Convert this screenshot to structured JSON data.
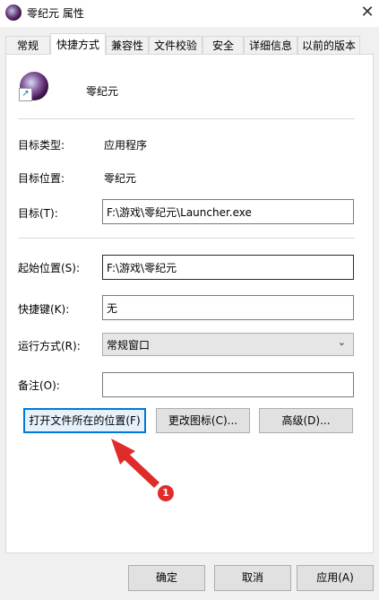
{
  "window": {
    "title": "零纪元 属性",
    "close_glyph": "✕"
  },
  "tabs": [
    {
      "label": "常规"
    },
    {
      "label": "快捷方式",
      "active": true
    },
    {
      "label": "兼容性"
    },
    {
      "label": "文件校验"
    },
    {
      "label": "安全"
    },
    {
      "label": "详细信息"
    },
    {
      "label": "以前的版本"
    }
  ],
  "shortcut": {
    "name": "零纪元",
    "target_type_label": "目标类型:",
    "target_type_value": "应用程序",
    "target_location_label": "目标位置:",
    "target_location_value": "零纪元",
    "target_label": "目标(T):",
    "target_value": "F:\\游戏\\零纪元\\Launcher.exe",
    "start_in_label": "起始位置(S):",
    "start_in_value": "F:\\游戏\\零纪元",
    "hotkey_label": "快捷键(K):",
    "hotkey_value": "无",
    "run_label": "运行方式(R):",
    "run_value": "常规窗口",
    "comment_label": "备注(O):",
    "comment_value": "",
    "open_location_button": "打开文件所在的位置(F)",
    "change_icon_button": "更改图标(C)...",
    "advanced_button": "高级(D)..."
  },
  "annotation": {
    "number": "1",
    "color": "#e02b2b"
  },
  "footer": {
    "ok": "确定",
    "cancel": "取消",
    "apply": "应用(A)"
  },
  "colors": {
    "accent": "#0078d7",
    "background": "#f0f0f0"
  }
}
